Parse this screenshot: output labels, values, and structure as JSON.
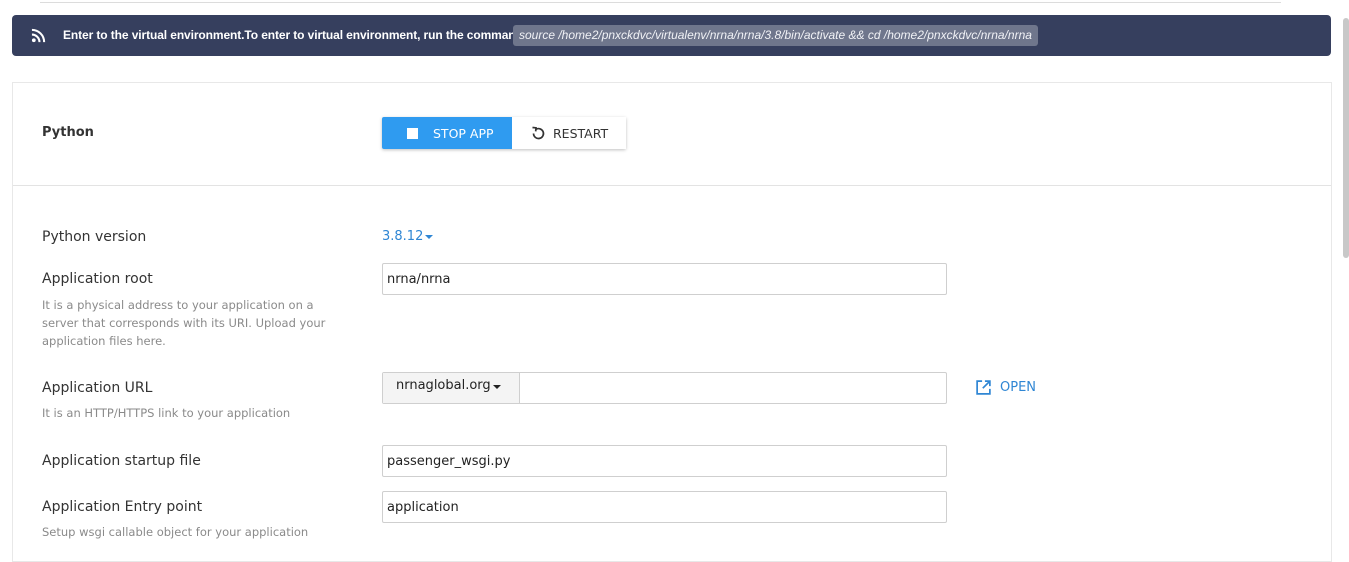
{
  "notice": {
    "icon": "rss-icon",
    "message": "Enter to the virtual environment.To enter to virtual environment, run the command:",
    "command": "source /home2/pnxckdvc/virtualenv/nrna/nrna/3.8/bin/activate && cd /home2/pnxckdvc/nrna/nrna",
    "background": "#363f5e"
  },
  "header": {
    "title": "Python",
    "stop_label": "STOP APP",
    "restart_label": "RESTART",
    "accent": "#2f9bf0"
  },
  "form": {
    "python_version": {
      "label": "Python version",
      "value": "3.8.12"
    },
    "app_root": {
      "label": "Application root",
      "value": "nrna/nrna",
      "hint": "It is a physical address to your application on a server that corresponds with its URI. Upload your application files here."
    },
    "app_url": {
      "label": "Application URL",
      "domain": "nrnaglobal.org",
      "path": "",
      "hint": "It is an HTTP/HTTPS link to your application",
      "open_label": "OPEN"
    },
    "startup_file": {
      "label": "Application startup file",
      "value": "passenger_wsgi.py"
    },
    "entry_point": {
      "label": "Application Entry point",
      "value": "application",
      "hint": "Setup wsgi callable object for your application"
    }
  }
}
